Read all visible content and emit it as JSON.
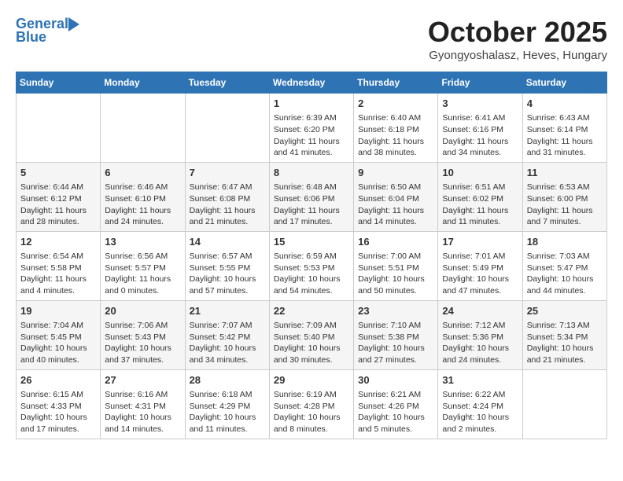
{
  "header": {
    "logo_general": "General",
    "logo_blue": "Blue",
    "month_title": "October 2025",
    "subtitle": "Gyongyoshalasz, Heves, Hungary"
  },
  "weekdays": [
    "Sunday",
    "Monday",
    "Tuesday",
    "Wednesday",
    "Thursday",
    "Friday",
    "Saturday"
  ],
  "weeks": [
    [
      {
        "day": "",
        "info": ""
      },
      {
        "day": "",
        "info": ""
      },
      {
        "day": "",
        "info": ""
      },
      {
        "day": "1",
        "info": "Sunrise: 6:39 AM\nSunset: 6:20 PM\nDaylight: 11 hours and 41 minutes."
      },
      {
        "day": "2",
        "info": "Sunrise: 6:40 AM\nSunset: 6:18 PM\nDaylight: 11 hours and 38 minutes."
      },
      {
        "day": "3",
        "info": "Sunrise: 6:41 AM\nSunset: 6:16 PM\nDaylight: 11 hours and 34 minutes."
      },
      {
        "day": "4",
        "info": "Sunrise: 6:43 AM\nSunset: 6:14 PM\nDaylight: 11 hours and 31 minutes."
      }
    ],
    [
      {
        "day": "5",
        "info": "Sunrise: 6:44 AM\nSunset: 6:12 PM\nDaylight: 11 hours and 28 minutes."
      },
      {
        "day": "6",
        "info": "Sunrise: 6:46 AM\nSunset: 6:10 PM\nDaylight: 11 hours and 24 minutes."
      },
      {
        "day": "7",
        "info": "Sunrise: 6:47 AM\nSunset: 6:08 PM\nDaylight: 11 hours and 21 minutes."
      },
      {
        "day": "8",
        "info": "Sunrise: 6:48 AM\nSunset: 6:06 PM\nDaylight: 11 hours and 17 minutes."
      },
      {
        "day": "9",
        "info": "Sunrise: 6:50 AM\nSunset: 6:04 PM\nDaylight: 11 hours and 14 minutes."
      },
      {
        "day": "10",
        "info": "Sunrise: 6:51 AM\nSunset: 6:02 PM\nDaylight: 11 hours and 11 minutes."
      },
      {
        "day": "11",
        "info": "Sunrise: 6:53 AM\nSunset: 6:00 PM\nDaylight: 11 hours and 7 minutes."
      }
    ],
    [
      {
        "day": "12",
        "info": "Sunrise: 6:54 AM\nSunset: 5:58 PM\nDaylight: 11 hours and 4 minutes."
      },
      {
        "day": "13",
        "info": "Sunrise: 6:56 AM\nSunset: 5:57 PM\nDaylight: 11 hours and 0 minutes."
      },
      {
        "day": "14",
        "info": "Sunrise: 6:57 AM\nSunset: 5:55 PM\nDaylight: 10 hours and 57 minutes."
      },
      {
        "day": "15",
        "info": "Sunrise: 6:59 AM\nSunset: 5:53 PM\nDaylight: 10 hours and 54 minutes."
      },
      {
        "day": "16",
        "info": "Sunrise: 7:00 AM\nSunset: 5:51 PM\nDaylight: 10 hours and 50 minutes."
      },
      {
        "day": "17",
        "info": "Sunrise: 7:01 AM\nSunset: 5:49 PM\nDaylight: 10 hours and 47 minutes."
      },
      {
        "day": "18",
        "info": "Sunrise: 7:03 AM\nSunset: 5:47 PM\nDaylight: 10 hours and 44 minutes."
      }
    ],
    [
      {
        "day": "19",
        "info": "Sunrise: 7:04 AM\nSunset: 5:45 PM\nDaylight: 10 hours and 40 minutes."
      },
      {
        "day": "20",
        "info": "Sunrise: 7:06 AM\nSunset: 5:43 PM\nDaylight: 10 hours and 37 minutes."
      },
      {
        "day": "21",
        "info": "Sunrise: 7:07 AM\nSunset: 5:42 PM\nDaylight: 10 hours and 34 minutes."
      },
      {
        "day": "22",
        "info": "Sunrise: 7:09 AM\nSunset: 5:40 PM\nDaylight: 10 hours and 30 minutes."
      },
      {
        "day": "23",
        "info": "Sunrise: 7:10 AM\nSunset: 5:38 PM\nDaylight: 10 hours and 27 minutes."
      },
      {
        "day": "24",
        "info": "Sunrise: 7:12 AM\nSunset: 5:36 PM\nDaylight: 10 hours and 24 minutes."
      },
      {
        "day": "25",
        "info": "Sunrise: 7:13 AM\nSunset: 5:34 PM\nDaylight: 10 hours and 21 minutes."
      }
    ],
    [
      {
        "day": "26",
        "info": "Sunrise: 6:15 AM\nSunset: 4:33 PM\nDaylight: 10 hours and 17 minutes."
      },
      {
        "day": "27",
        "info": "Sunrise: 6:16 AM\nSunset: 4:31 PM\nDaylight: 10 hours and 14 minutes."
      },
      {
        "day": "28",
        "info": "Sunrise: 6:18 AM\nSunset: 4:29 PM\nDaylight: 10 hours and 11 minutes."
      },
      {
        "day": "29",
        "info": "Sunrise: 6:19 AM\nSunset: 4:28 PM\nDaylight: 10 hours and 8 minutes."
      },
      {
        "day": "30",
        "info": "Sunrise: 6:21 AM\nSunset: 4:26 PM\nDaylight: 10 hours and 5 minutes."
      },
      {
        "day": "31",
        "info": "Sunrise: 6:22 AM\nSunset: 4:24 PM\nDaylight: 10 hours and 2 minutes."
      },
      {
        "day": "",
        "info": ""
      }
    ]
  ]
}
